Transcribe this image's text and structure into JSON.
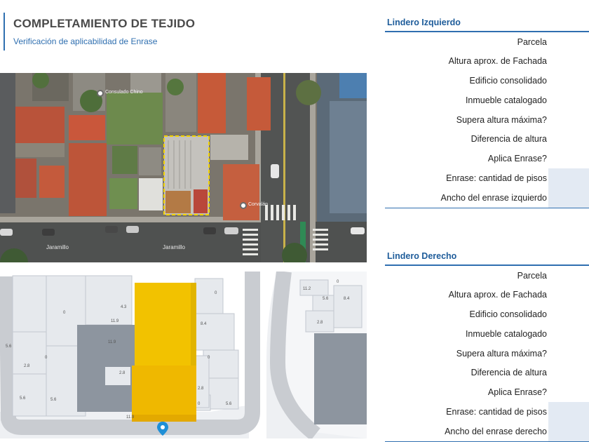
{
  "header": {
    "title": "COMPLETAMIENTO DE TEJIDO",
    "subtitle": "Verificación de aplicabilidad de Enrase"
  },
  "aerial": {
    "street_label": "Jaramillo",
    "pins": [
      "Consulado Chino",
      "Corvalán"
    ]
  },
  "map3d": {
    "height_labels": [
      "4.3",
      "11.9",
      "11.9",
      "8.4",
      "0",
      "2.8",
      "2.8",
      "5.6",
      "5.6",
      "2.8",
      "0",
      "5.6",
      "0",
      "0",
      "11.9",
      "5.6",
      "0",
      "8.4",
      "2.8",
      "0",
      "11.2",
      "5.6"
    ]
  },
  "left_panel": {
    "title": "Lindero Izquierdo",
    "rows": [
      {
        "label": "Parcela"
      },
      {
        "label": "Altura aprox. de Fachada"
      },
      {
        "label": "Edificio consolidado"
      },
      {
        "label": "Inmueble catalogado"
      },
      {
        "label": "Supera altura máxima?"
      },
      {
        "label": "Diferencia de altura"
      },
      {
        "label": "Aplica Enrase?"
      },
      {
        "label": "Enrase: cantidad de pisos"
      },
      {
        "label": "Ancho del enrase izquierdo"
      }
    ]
  },
  "right_panel": {
    "title": "Lindero Derecho",
    "rows": [
      {
        "label": "Parcela"
      },
      {
        "label": "Altura aprox. de Fachada"
      },
      {
        "label": "Edificio consolidado"
      },
      {
        "label": "Inmueble catalogado"
      },
      {
        "label": "Supera altura máxima?"
      },
      {
        "label": "Diferencia de altura"
      },
      {
        "label": "Aplica Enrase?"
      },
      {
        "label": "Enrase: cantidad de pisos"
      },
      {
        "label": "Ancho del enrase derecho"
      }
    ]
  },
  "colors": {
    "accent": "#2f6fb0",
    "title_blue": "#1e5c9a",
    "parcel_highlight": "#f2c200",
    "shade": "#e3eaf3"
  }
}
